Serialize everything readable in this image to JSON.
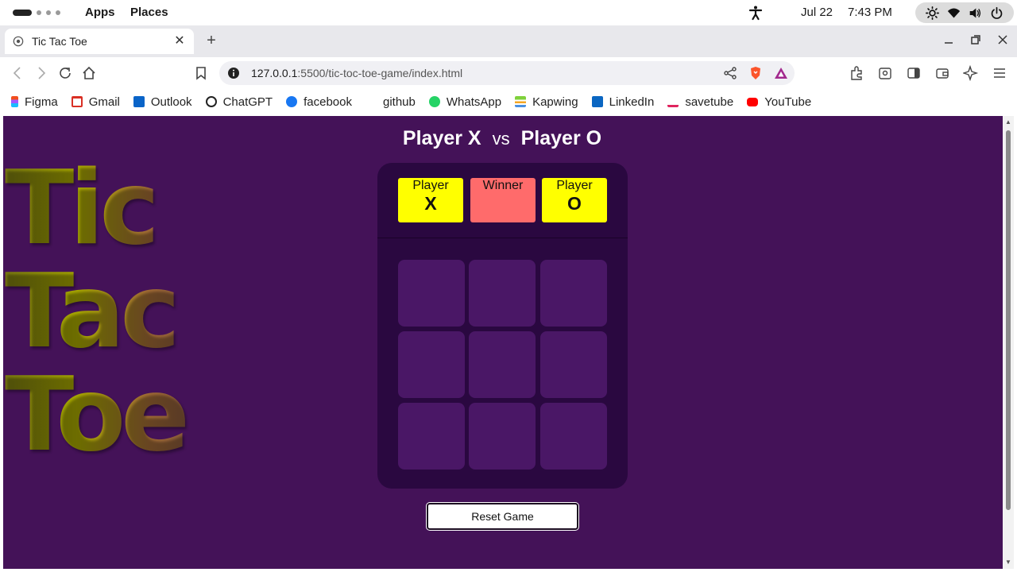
{
  "system_bar": {
    "apps_label": "Apps",
    "places_label": "Places",
    "date": "Jul 22",
    "time": "7:43 PM"
  },
  "browser": {
    "tab_title": "Tic Tac Toe",
    "new_tab_icon": "plus-icon",
    "url_host": "127.0.0.1",
    "url_path": ":5500/tic-toc-toe-game/index.html",
    "bookmarks": [
      {
        "label": "Figma",
        "color": "#f24e1e"
      },
      {
        "label": "Gmail",
        "color": "#d93025"
      },
      {
        "label": "Outlook",
        "color": "#0a64c8"
      },
      {
        "label": "ChatGPT",
        "color": "#222222"
      },
      {
        "label": "facebook",
        "color": "#1877f2"
      },
      {
        "label": "github",
        "color": "#ffffff"
      },
      {
        "label": "WhatsApp",
        "color": "#25d366"
      },
      {
        "label": "Kapwing",
        "color": "#7fd13b"
      },
      {
        "label": "LinkedIn",
        "color": "#0a66c2"
      },
      {
        "label": "savetube",
        "color": "#e0245e"
      },
      {
        "label": "YouTube",
        "color": "#ff0000"
      }
    ]
  },
  "page": {
    "player_x_title": "Player X",
    "vs_label": "vs",
    "player_o_title": "Player O",
    "big_title": [
      "Tic",
      "Tac",
      "Toe"
    ],
    "scoreboard": {
      "x_label": "Player",
      "x_mark": "X",
      "winner_label": "Winner",
      "winner_value": "",
      "o_label": "Player",
      "o_mark": "O"
    },
    "cells": [
      "",
      "",
      "",
      "",
      "",
      "",
      "",
      "",
      ""
    ],
    "reset_label": "Reset Game",
    "colors": {
      "background": "#441258",
      "board": "#2a0840",
      "cell": "#4a1766",
      "player_badge": "#ffff00",
      "winner_badge": "#ff6b6b"
    }
  }
}
